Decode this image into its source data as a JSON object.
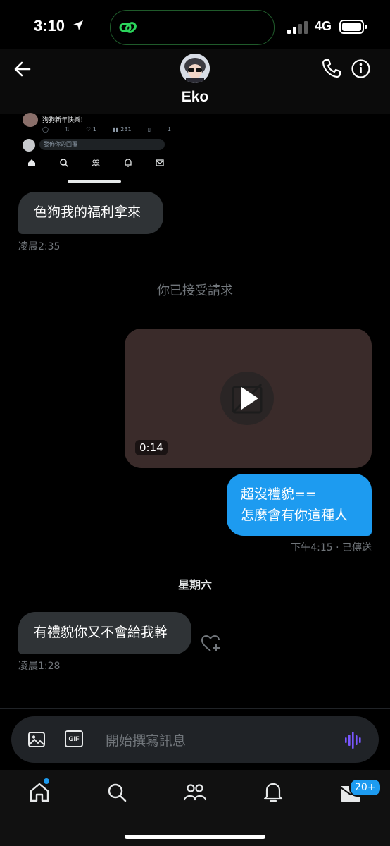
{
  "status_bar": {
    "time": "3:10",
    "network": "4G"
  },
  "header": {
    "title": "Eko"
  },
  "preview": {
    "post_text": "狗狗新年快樂！",
    "counts": {
      "likes": "1",
      "views": "231"
    },
    "reply_placeholder": "發佈你的回覆"
  },
  "messages": [
    {
      "text": "色狗我的福利拿來",
      "time": "凌晨2:35"
    },
    {
      "system": "你已接受請求"
    },
    {
      "video_duration": "0:14"
    },
    {
      "lines": [
        "超沒禮貌==",
        "怎麼會有你這種人"
      ],
      "meta": "下午4:15 · 已傳送"
    },
    {
      "day": "星期六"
    },
    {
      "text": "有禮貌你又不會給我幹",
      "time": "凌晨1:28"
    }
  ],
  "composer": {
    "placeholder": "開始撰寫訊息",
    "gif_label": "GIF"
  },
  "tabbar": {
    "messages_badge": "20+"
  },
  "colors": {
    "accent": "#1d9bf0",
    "incoming_bubble": "#2f3336",
    "background": "#000000",
    "voice_icon": "#7856ff"
  }
}
